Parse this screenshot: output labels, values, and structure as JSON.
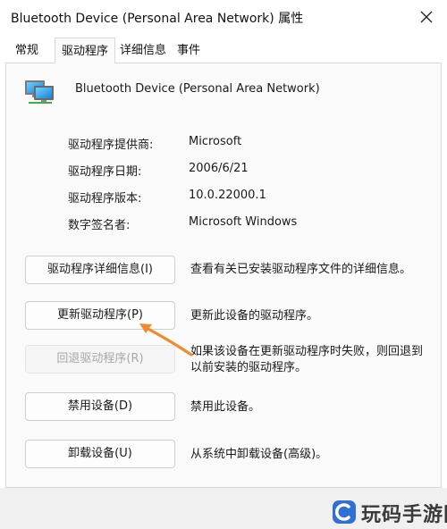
{
  "window": {
    "title": "Bluetooth Device (Personal Area Network) 属性"
  },
  "tabs": [
    {
      "label": "常规",
      "active": false
    },
    {
      "label": "驱动程序",
      "active": true
    },
    {
      "label": "详细信息",
      "active": false
    },
    {
      "label": "事件",
      "active": false
    }
  ],
  "device": {
    "name": "Bluetooth Device (Personal Area Network)",
    "icon": "network-adapter-icon"
  },
  "info": [
    {
      "label": "驱动程序提供商:",
      "value": "Microsoft"
    },
    {
      "label": "驱动程序日期:",
      "value": "2006/6/21"
    },
    {
      "label": "驱动程序版本:",
      "value": "10.0.22000.1"
    },
    {
      "label": "数字签名者:",
      "value": "Microsoft Windows"
    }
  ],
  "actions": [
    {
      "button": "驱动程序详细信息(I)",
      "description": "查看有关已安装驱动程序文件的详细信息。",
      "enabled": true
    },
    {
      "button": "更新驱动程序(P)",
      "description": "更新此设备的驱动程序。",
      "enabled": true
    },
    {
      "button": "回退驱动程序(R)",
      "description": "如果该设备在更新驱动程序时失败，则回退到以前安装的驱动程序。",
      "enabled": false
    },
    {
      "button": "禁用设备(D)",
      "description": "禁用此设备。",
      "enabled": true
    },
    {
      "button": "卸载设备(U)",
      "description": "从系统中卸载设备(高级)。",
      "enabled": true
    }
  ],
  "annotation": {
    "arrow_color": "#f08a2c"
  },
  "watermark": {
    "text": "玩码手游网"
  },
  "colors": {
    "border": "#d9d9d9",
    "panel_bg": "#fafafa",
    "disabled_text": "#a8a8a8"
  }
}
